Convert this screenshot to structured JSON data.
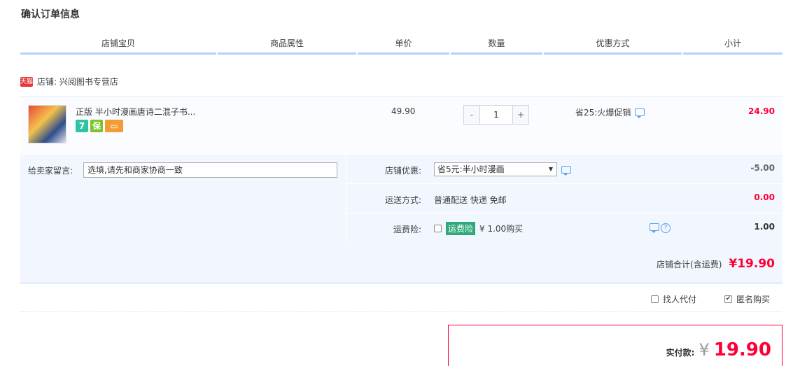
{
  "page_title": "确认订单信息",
  "columns": [
    "店铺宝贝",
    "商品属性",
    "单价",
    "数量",
    "优惠方式",
    "小计"
  ],
  "shop": {
    "badge": "天猫",
    "label": "店铺: 兴阅图书专营店"
  },
  "item": {
    "title": "正版 半小时漫画唐诗二混子书...",
    "icons": [
      "seven-day-return-icon",
      "guarantee-icon",
      "credit-card-icon"
    ],
    "icon_glyphs": [
      "7",
      "保",
      "▭"
    ],
    "unit_price": "49.90",
    "quantity": "1",
    "minus": "-",
    "plus": "+",
    "promotion": "省25:火爆促销",
    "subtotal": "24.90"
  },
  "message": {
    "label": "给卖家留言:",
    "placeholder": "选填,请先和商家协商一致"
  },
  "shop_discount": {
    "label": "店铺优惠:",
    "selected": "省5元:半小时漫画",
    "amount": "-5.00"
  },
  "shipping": {
    "label": "运送方式:",
    "value": "普通配送 快递 免邮",
    "amount": "0.00"
  },
  "insurance": {
    "label": "运费险:",
    "tag": "运费险",
    "value": "¥ 1.00购买",
    "amount": "1.00"
  },
  "shop_total": {
    "label": "店铺合计(含运费)",
    "amount": "¥19.90"
  },
  "options": {
    "proxy_pay": "找人代付",
    "anonymous": "匿名购买"
  },
  "payment": {
    "label": "实付款:",
    "currency": "¥",
    "amount": "19.90"
  },
  "colors": {
    "accent_red": "#ff0036",
    "header_blue": "#b2d1ff",
    "panel_bg": "#f2f7ff"
  }
}
